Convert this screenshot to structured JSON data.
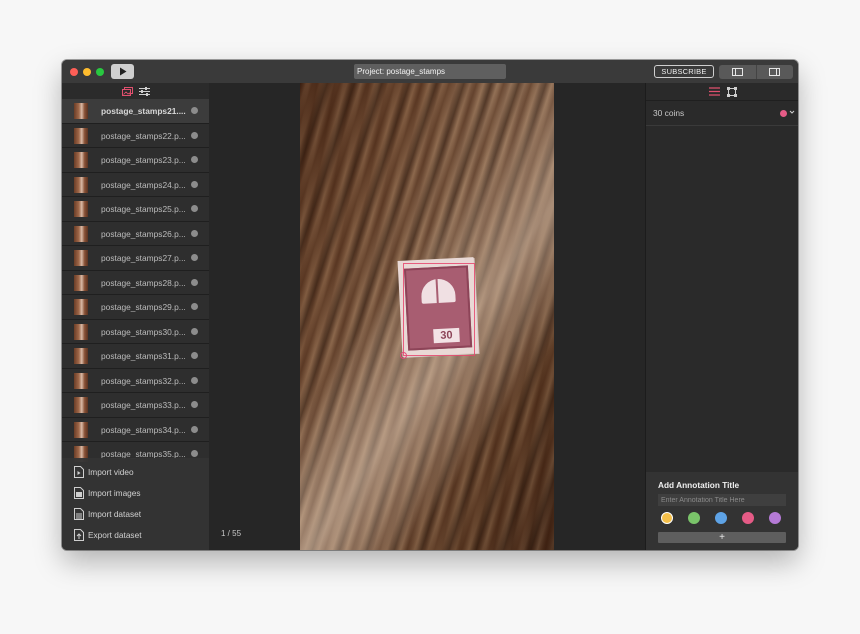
{
  "window": {
    "project_title": "Project: postage_stamps",
    "subscribe_label": "SUBSCRIBE"
  },
  "sidebar": {
    "files": [
      {
        "name": "postage_stamps21....",
        "selected": true
      },
      {
        "name": "postage_stamps22.p..."
      },
      {
        "name": "postage_stamps23.p..."
      },
      {
        "name": "postage_stamps24.p..."
      },
      {
        "name": "postage_stamps25.p..."
      },
      {
        "name": "postage_stamps26.p..."
      },
      {
        "name": "postage_stamps27.p..."
      },
      {
        "name": "postage_stamps28.p..."
      },
      {
        "name": "postage_stamps29.p..."
      },
      {
        "name": "postage_stamps30.p..."
      },
      {
        "name": "postage_stamps31.p..."
      },
      {
        "name": "postage_stamps32.p..."
      },
      {
        "name": "postage_stamps33.p..."
      },
      {
        "name": "postage_stamps34.p..."
      },
      {
        "name": "postage_stamps35.p..."
      }
    ],
    "actions": {
      "import_video": "Import video",
      "import_images": "Import images",
      "import_dataset": "Import dataset",
      "export_dataset": "Export dataset"
    }
  },
  "canvas": {
    "counter": "1 / 55",
    "stamp_value": "30"
  },
  "annotations": {
    "label": "30 coins",
    "label_color": "#e55b86"
  },
  "add_annotation": {
    "title": "Add Annotation Title",
    "placeholder": "Enter Annotation Title Here",
    "colors": [
      "#f5c04a",
      "#7ac46a",
      "#5ea3e6",
      "#e55b86",
      "#b57ad6"
    ],
    "selected_color_index": 0,
    "add_label": "+"
  }
}
